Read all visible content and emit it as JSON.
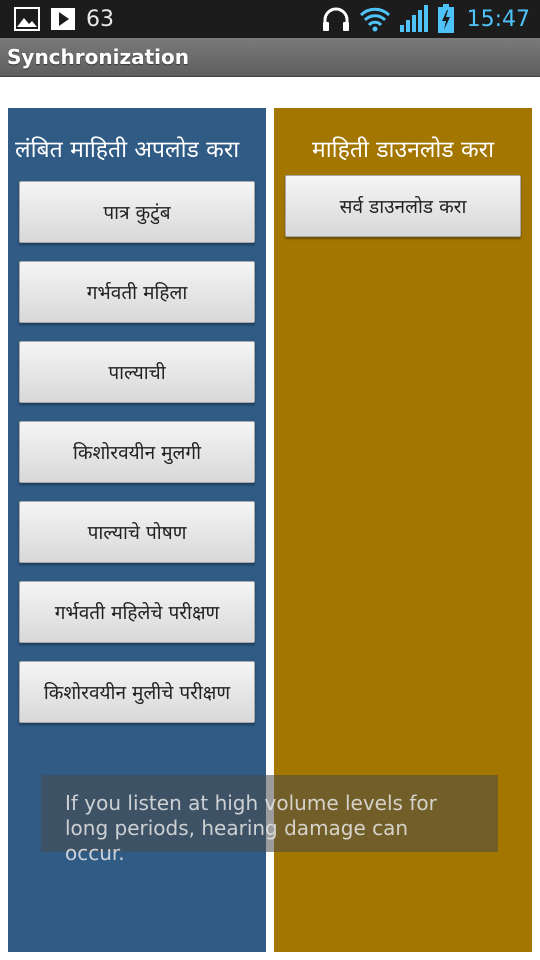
{
  "status_bar": {
    "notification_count": "63",
    "time": "15:47",
    "icons": [
      "image-icon",
      "play-icon",
      "headphones-icon",
      "wifi-icon",
      "signal-icon",
      "battery-icon"
    ]
  },
  "app": {
    "title": "Synchronization"
  },
  "upload_panel": {
    "heading": "लंबित माहिती अपलोड करा",
    "color": "#2f5b85",
    "buttons": [
      "पात्र कुटुंब",
      "गर्भवती महिला",
      "पाल्याची",
      "किशोरवयीन मुलगी",
      "पाल्याचे पोषण",
      "गर्भवती महिलेचे परीक्षण",
      "किशोरवयीन मुलीचे परीक्षण"
    ]
  },
  "download_panel": {
    "heading": "माहिती डाउनलोड करा",
    "color": "#a37600",
    "buttons": [
      "सर्व डाउनलोड करा"
    ]
  },
  "toast": {
    "message": "If you listen at high volume levels for long periods, hearing damage can occur."
  }
}
